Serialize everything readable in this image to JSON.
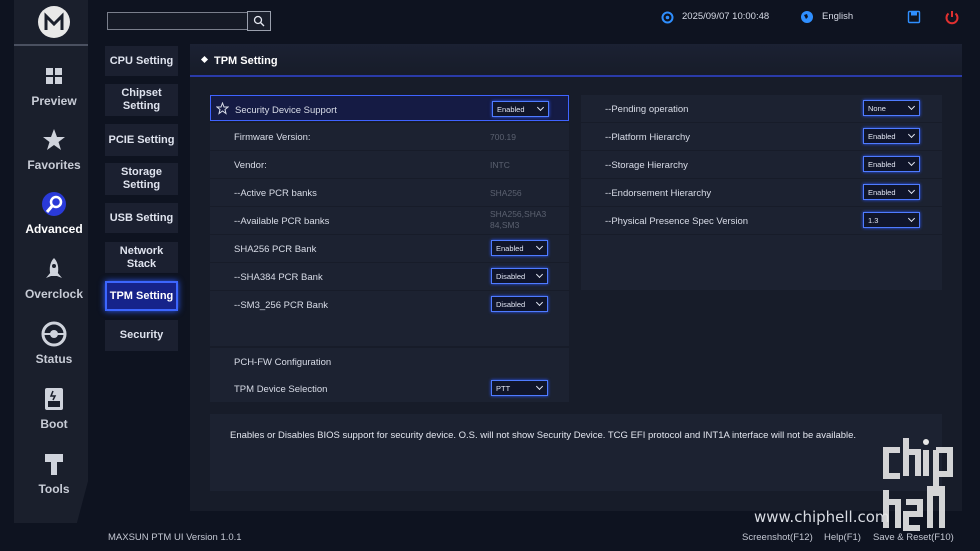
{
  "sidebar": {
    "items": [
      {
        "label": "Preview",
        "icon": "grid-icon"
      },
      {
        "label": "Favorites",
        "icon": "star-icon"
      },
      {
        "label": "Advanced",
        "icon": "wrench-gear-icon",
        "active": true
      },
      {
        "label": "Overclock",
        "icon": "rocket-icon"
      },
      {
        "label": "Status",
        "icon": "gauge-icon"
      },
      {
        "label": "Boot",
        "icon": "ssd-icon"
      },
      {
        "label": "Tools",
        "icon": "tool-icon"
      }
    ]
  },
  "submenu": {
    "items": [
      {
        "label": "CPU Setting"
      },
      {
        "label": "Chipset Setting"
      },
      {
        "label": "PCIE Setting"
      },
      {
        "label": "Storage Setting"
      },
      {
        "label": "USB Setting"
      },
      {
        "label": "Network Stack"
      },
      {
        "label": "TPM Setting",
        "active": true
      },
      {
        "label": "Security"
      }
    ]
  },
  "header": {
    "search_placeholder": "",
    "datetime": "2025/09/07  10:00:48",
    "language": "English"
  },
  "panel": {
    "title": "TPM Setting",
    "left": {
      "security_device_support": {
        "label": "Security Device Support",
        "value": "Enabled"
      },
      "firmware_version": {
        "label": "Firmware Version:",
        "value": "700.19"
      },
      "vendor": {
        "label": "Vendor:",
        "value": "INTC"
      },
      "active_pcr": {
        "label": "--Active PCR banks",
        "value": "SHA256"
      },
      "available_pcr": {
        "label": "--Available PCR banks",
        "value": "SHA256,SHA3 84,SM3"
      },
      "sha256": {
        "label": "SHA256 PCR Bank",
        "value": "Enabled"
      },
      "sha384": {
        "label": "--SHA384 PCR Bank",
        "value": "Disabled"
      },
      "sm3": {
        "label": "--SM3_256 PCR Bank",
        "value": "Disabled"
      },
      "pch_fw": {
        "label": "PCH-FW Configuration"
      },
      "tpm_device": {
        "label": "TPM Device Selection",
        "value": "PTT"
      }
    },
    "right": {
      "pending": {
        "label": "--Pending operation",
        "value": "None"
      },
      "platform": {
        "label": "--Platform Hierarchy",
        "value": "Enabled"
      },
      "storage": {
        "label": "--Storage Hierarchy",
        "value": "Enabled"
      },
      "endorsement": {
        "label": "--Endorsement Hierarchy",
        "value": "Enabled"
      },
      "pps": {
        "label": "--Physical Presence Spec Version",
        "value": "1.3"
      }
    },
    "help_text": "Enables or Disables BIOS support for security device. O.S. will not show Security Device. TCG EFI protocol and INT1A interface will not be available."
  },
  "footer": {
    "version": "MAXSUN PTM UI Version 1.0.1",
    "screenshot": "Screenshot(F12)",
    "help": "Help(F1)",
    "save_reset": "Save & Reset(F10)"
  },
  "watermark": {
    "url": "www.chiphell.com",
    "text": "chip hell"
  },
  "colors": {
    "accent": "#3c66ff",
    "background": "#0e1320",
    "power": "#e03030"
  }
}
